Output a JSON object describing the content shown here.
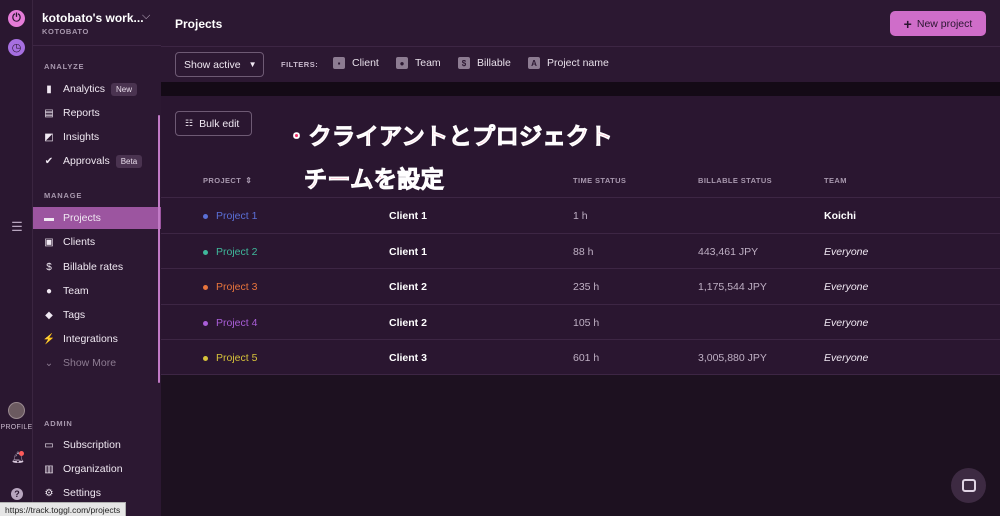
{
  "rail": {
    "profile_label": "PROFILE"
  },
  "sidebar": {
    "workspace_name": "kotobato's work...",
    "workspace_sub": "KOTOBATO",
    "sections": {
      "analyze": "ANALYZE",
      "manage": "MANAGE",
      "admin": "ADMIN"
    },
    "analyze_items": [
      {
        "label": "Analytics",
        "badge": "New",
        "icon": "analytics-icon"
      },
      {
        "label": "Reports",
        "icon": "reports-icon"
      },
      {
        "label": "Insights",
        "icon": "insights-icon"
      },
      {
        "label": "Approvals",
        "badge": "Beta",
        "icon": "approvals-icon"
      }
    ],
    "manage_items": [
      {
        "label": "Projects",
        "icon": "folder-icon",
        "active": true
      },
      {
        "label": "Clients",
        "icon": "clients-icon"
      },
      {
        "label": "Billable rates",
        "icon": "dollar-icon"
      },
      {
        "label": "Team",
        "icon": "team-icon"
      },
      {
        "label": "Tags",
        "icon": "tag-icon"
      },
      {
        "label": "Integrations",
        "icon": "plug-icon"
      },
      {
        "label": "Show More",
        "icon": "chevron-down-icon"
      }
    ],
    "admin_items": [
      {
        "label": "Subscription",
        "icon": "card-icon"
      },
      {
        "label": "Organization",
        "icon": "building-icon"
      },
      {
        "label": "Settings",
        "icon": "gear-icon"
      }
    ]
  },
  "status_url": "https://track.toggl.com/projects",
  "header": {
    "title": "Projects",
    "new_project_label": "New project"
  },
  "filterbar": {
    "show_active_label": "Show active",
    "filters_label": "FILTERS:",
    "filters": [
      "Client",
      "Team",
      "Billable",
      "Project name"
    ]
  },
  "toolbar": {
    "bulk_edit_label": "Bulk edit"
  },
  "overlay": {
    "line1": "・クライアントとプロジェクト",
    "line2": "チームを設定"
  },
  "table": {
    "headers": {
      "project": "PROJECT",
      "time_status": "TIME STATUS",
      "billable_status": "BILLABLE STATUS",
      "team": "TEAM"
    },
    "rows": [
      {
        "project": "Project 1",
        "color": "#5a6fd6",
        "client": "Client 1",
        "time": "1 h",
        "billable": "",
        "team": "Koichi",
        "team_style": "bold"
      },
      {
        "project": "Project 2",
        "color": "#3fb89b",
        "client": "Client 1",
        "time": "88 h",
        "billable": "443,461 JPY",
        "team": "Everyone",
        "team_style": "italic"
      },
      {
        "project": "Project 3",
        "color": "#e8743c",
        "client": "Client 2",
        "time": "235 h",
        "billable": "1,175,544 JPY",
        "team": "Everyone",
        "team_style": "italic"
      },
      {
        "project": "Project 4",
        "color": "#a95ed8",
        "client": "Client 2",
        "time": "105 h",
        "billable": "",
        "team": "Everyone",
        "team_style": "italic"
      },
      {
        "project": "Project 5",
        "color": "#d6c23a",
        "client": "Client 3",
        "time": "601 h",
        "billable": "3,005,880 JPY",
        "team": "Everyone",
        "team_style": "italic"
      }
    ]
  }
}
